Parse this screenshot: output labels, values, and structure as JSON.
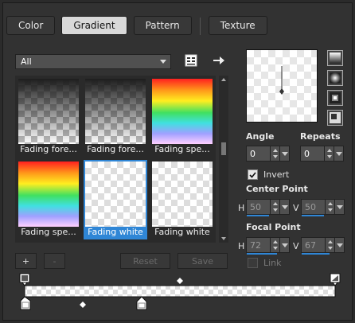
{
  "tabs": [
    {
      "label": "Color",
      "active": false
    },
    {
      "label": "Gradient",
      "active": true
    },
    {
      "label": "Pattern",
      "active": false
    },
    {
      "label": "Texture",
      "active": false
    }
  ],
  "category_select": {
    "value": "All"
  },
  "gradients": [
    {
      "label": "Fading fore...",
      "kind": "fade-dark",
      "selected": false
    },
    {
      "label": "Fading fore...",
      "kind": "fade-dark",
      "selected": false
    },
    {
      "label": "Fading spe...",
      "kind": "spectrum",
      "selected": false
    },
    {
      "label": "Fading spe...",
      "kind": "spectrum",
      "selected": false
    },
    {
      "label": "Fading white",
      "kind": "white",
      "selected": true
    },
    {
      "label": "Fading white",
      "kind": "white",
      "selected": false
    }
  ],
  "angle": {
    "label": "Angle",
    "value": "0"
  },
  "repeats": {
    "label": "Repeats",
    "value": "0"
  },
  "invert": {
    "label": "Invert",
    "checked": true
  },
  "center_point": {
    "label": "Center Point",
    "h_label": "H",
    "h_value": "50",
    "v_label": "V",
    "v_value": "50"
  },
  "focal_point": {
    "label": "Focal Point",
    "h_label": "H",
    "h_value": "72",
    "v_label": "V",
    "v_value": "67"
  },
  "link": {
    "label": "Link",
    "checked": false
  },
  "buttons": {
    "add": "+",
    "remove": "-",
    "reset": "Reset",
    "save": "Save"
  },
  "icons": [
    "gradient-list-icon",
    "arrow-right-icon",
    "linear-gradient-icon",
    "radial-gradient-icon",
    "rectangular-gradient-icon",
    "sunburst-gradient-icon"
  ],
  "colors": {
    "accent": "#2f86d6",
    "panel": "#323232"
  }
}
